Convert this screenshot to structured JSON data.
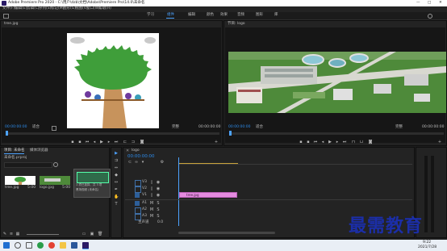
{
  "window": {
    "title": "Adobe Premiere Pro 2020 - C:\\用户\\dzb\\文档\\Adobe\\Premiere Pro\\14.0\\未命名",
    "controls": [
      "—",
      "□",
      "✕"
    ]
  },
  "menu": [
    "文件(F)",
    "编辑(E)",
    "剪辑(C)",
    "序列(S)",
    "标记(M)",
    "图形(G)",
    "视图(V)",
    "窗口(W)",
    "帮助(H)"
  ],
  "workspaces": [
    "学习",
    "组件",
    "编辑",
    "颜色",
    "效果",
    "音频",
    "图形",
    "库"
  ],
  "workspaces_active": 1,
  "source_monitor": {
    "tab": "tree.jpg",
    "timecode_left": "00:00:00:00",
    "fit": "适合",
    "quality": "完整",
    "timecode_right": "00:00:00:00"
  },
  "program_monitor": {
    "tab": "节目: logo",
    "timecode_left": "00:00:00:00",
    "fit": "适合",
    "quality": "完整",
    "timecode_right": "00:00:00:00"
  },
  "project": {
    "tab_active": "项目: 未命名",
    "tab_other": "媒体浏览器",
    "path": "未命名.prproj",
    "items": [
      {
        "label": "tree.jpg",
        "duration": "5:00"
      },
      {
        "label": "logo.jpg",
        "duration": "5:00"
      }
    ],
    "tooltip_title": "1 项已选择，共 3 项",
    "tooltip_name": "黑场视频 (未命名)"
  },
  "timeline": {
    "tab": "logo",
    "timecode": "00:00:00:00",
    "tracks_video": [
      "V3",
      "V2",
      "V1"
    ],
    "tracks_audio": [
      "A1",
      "A2",
      "A3"
    ],
    "master": "主声道",
    "master_value": "0.0",
    "clip_label": "tree.jpg"
  },
  "taskbar": {
    "time": "9:22",
    "date": "2021/7/28"
  },
  "watermark": "最需教育"
}
